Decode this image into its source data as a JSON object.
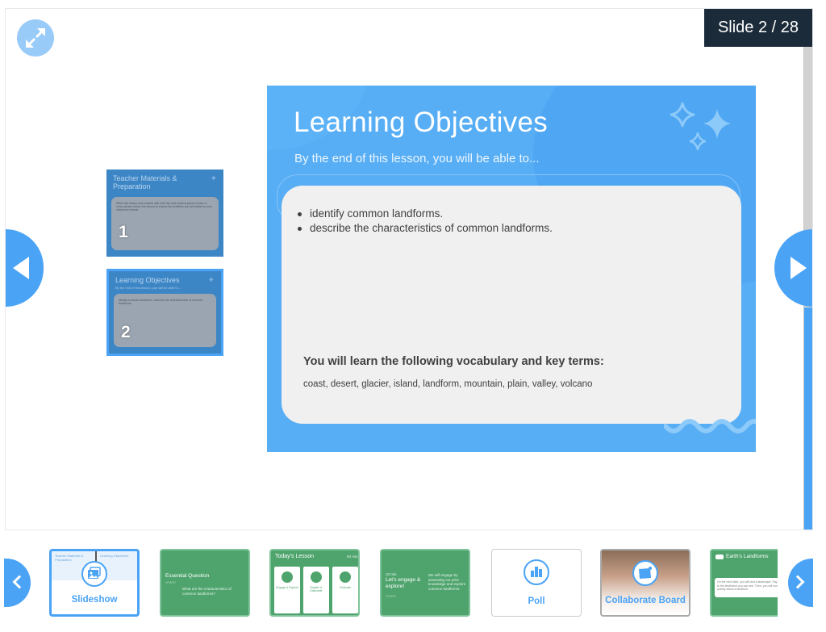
{
  "viewer": {
    "expand_icon": "expand-arrows-icon",
    "slide_counter": "Slide 2 / 28",
    "current_slide": 2,
    "total_slides": 28,
    "progress_fraction": 0.46,
    "prev_icon": "triangle-left-icon",
    "next_icon": "triangle-right-icon"
  },
  "side_thumbnails": [
    {
      "number": "1",
      "title": "Teacher Materials & Preparation",
      "text": "While this lesson was created with both live and student-paced modes in mind, please review the lesson to ensure the activities are well-suited to your classroom format."
    },
    {
      "number": "2",
      "title": "Learning Objectives",
      "subtitle": "By the end of this lesson, you will be able to...",
      "text": "identify common landforms. describe the characteristics of common landforms.",
      "selected": true
    }
  ],
  "slide": {
    "title": "Learning Objectives",
    "subtitle": "By the end of this lesson, you will be able to...",
    "objectives": [
      "identify common landforms.",
      "describe the characteristics of common landforms."
    ],
    "vocab_heading": "You will learn the following vocabulary and key terms:",
    "vocab_terms": "coast, desert, glacier, island, landform, mountain, plain, valley, volcano",
    "colors": {
      "background": "#57aef5",
      "card": "#f0f0f0",
      "text": "#404040"
    }
  },
  "carousel": {
    "prev_icon": "chevron-left-icon",
    "next_icon": "chevron-right-icon",
    "items": [
      {
        "type": "slideshow",
        "label": "Slideshow",
        "icon": "image-stack-icon",
        "mini_left": "Teacher Materials & Preparation",
        "mini_right": "Learning Objectives"
      },
      {
        "type": "slide",
        "title": "Essential Question",
        "text": "What are the characteristics of common landforms?"
      },
      {
        "type": "slide",
        "title": "Today's Lesson",
        "duration": "50 min",
        "panels": [
          "Engage & Explore",
          "Explain & Elaborate",
          "Evaluate"
        ]
      },
      {
        "type": "slide",
        "time": "10 min",
        "title": "Let's engage & explore!",
        "text": "We will engage by assessing our prior knowledge and explore common landforms."
      },
      {
        "type": "poll",
        "label": "Poll",
        "icon": "bar-chart-icon"
      },
      {
        "type": "collaborate",
        "label": "Collaborate Board",
        "icon": "board-icon"
      },
      {
        "type": "slide",
        "title": "Earth's Landforms",
        "icon": "vr-headset-icon",
        "text": "On the next slide, you will visit a landscape. Pay attention to the landforms you can see. Then, you will complete an activity about a landform."
      }
    ]
  },
  "colors": {
    "accent": "#4aa3f5",
    "counter_bg": "#1c2b39",
    "green_slide": "#4fa46d",
    "expand_button": "#99cbf9"
  }
}
